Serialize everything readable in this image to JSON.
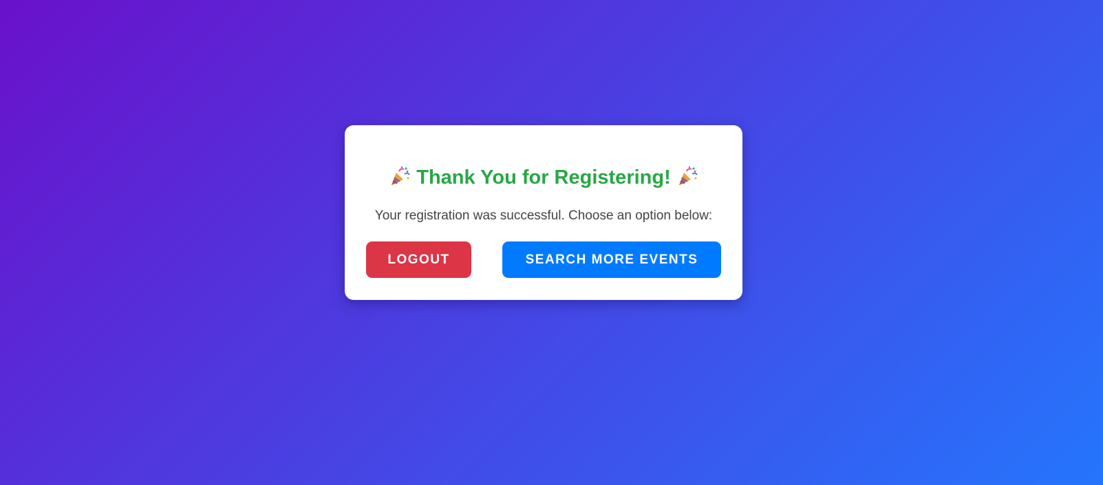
{
  "card": {
    "title": "Thank You for Registering!",
    "message": "Your registration was successful. Choose an option below:"
  },
  "icons": {
    "left": "party-popper-icon",
    "right": "party-popper-icon"
  },
  "actions": {
    "logout_label": "LOGOUT",
    "search_label": "SEARCH MORE EVENTS"
  },
  "colors": {
    "background_start": "#6a11cb",
    "background_end": "#2575fc",
    "title": "#28a745",
    "logout": "#dc3545",
    "search": "#007bff"
  }
}
